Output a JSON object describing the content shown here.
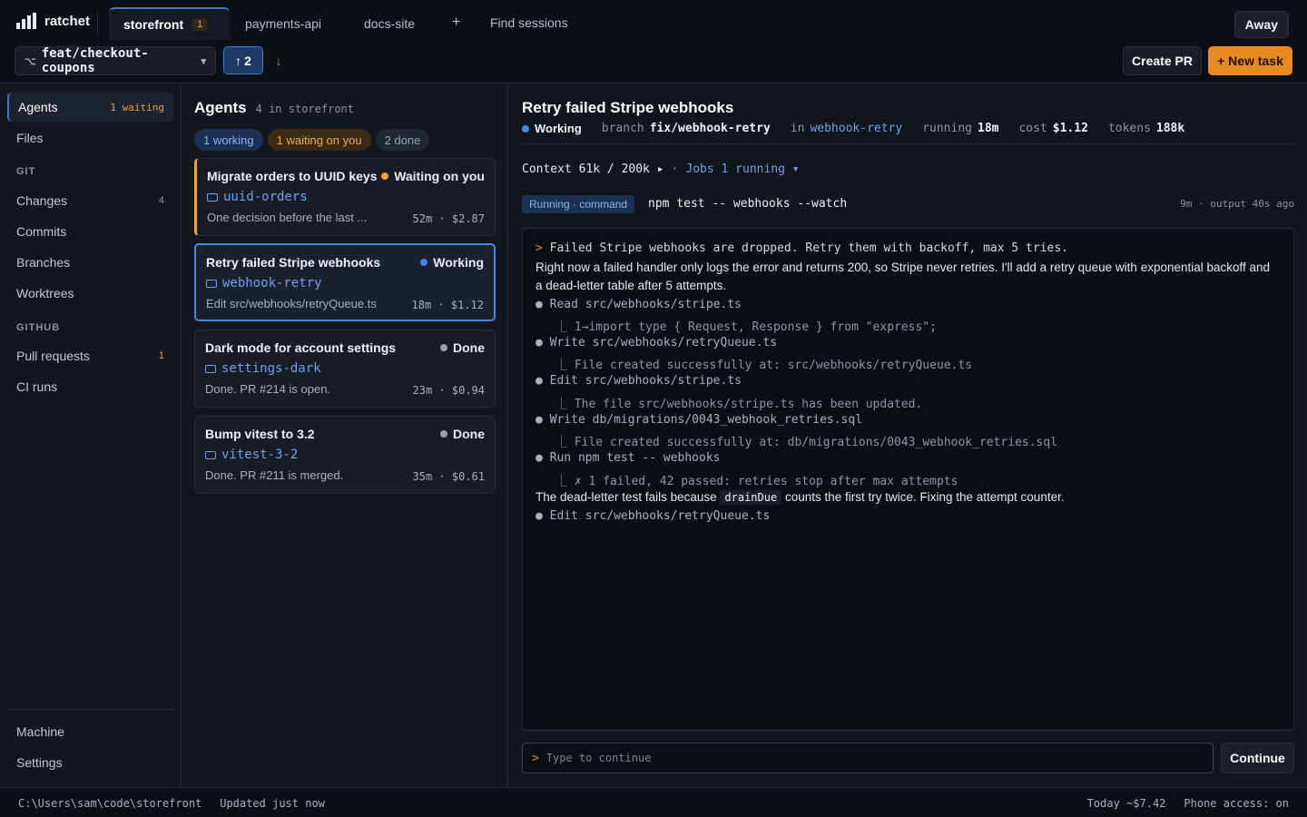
{
  "app": {
    "name": "ratchet"
  },
  "tabs": [
    {
      "label": "storefront",
      "badge": "1",
      "active": true
    },
    {
      "label": "payments-api"
    },
    {
      "label": "docs-site"
    }
  ],
  "topbar": {
    "add_tab": "+",
    "find_sessions": "Find sessions",
    "away": "Away"
  },
  "branch": {
    "name": "feat/checkout-coupons",
    "push_label": "2",
    "push_icon": "↑",
    "pull_icon": "↓"
  },
  "actions": {
    "create_pr": "Create PR",
    "new_task": "+ New task"
  },
  "sidebar": {
    "agents": {
      "label": "Agents",
      "count": "1 waiting"
    },
    "files": "Files",
    "git_header": "GIT",
    "changes": {
      "label": "Changes",
      "count": "4"
    },
    "commits": "Commits",
    "branches": "Branches",
    "worktrees": "Worktrees",
    "github_header": "GITHUB",
    "pull_requests": {
      "label": "Pull requests",
      "count": "1"
    },
    "ci_runs": "CI runs",
    "machine": "Machine",
    "settings": "Settings"
  },
  "agents_panel": {
    "title": "Agents",
    "subtitle": "4 in storefront",
    "filters": [
      "1 working",
      "1 waiting on you",
      "2 done"
    ],
    "cards": [
      {
        "title": "Migrate orders to UUID keys",
        "status": "Waiting on you",
        "status_color": "#e5a33f",
        "branch": "uuid-orders",
        "desc": "One decision before the last ...",
        "meta": "52m · $2.87"
      },
      {
        "title": "Retry failed Stripe webhooks",
        "status": "Working",
        "status_color": "#4a86e8",
        "branch": "webhook-retry",
        "desc": "Edit src/webhooks/retryQueue.ts",
        "meta": "18m · $1.12"
      },
      {
        "title": "Dark mode for account settings",
        "status": "Done",
        "status_color": "#9aa1ac",
        "branch": "settings-dark",
        "desc": "Done. PR #214 is open.",
        "meta": "23m · $0.94"
      },
      {
        "title": "Bump vitest to 3.2",
        "status": "Done",
        "status_color": "#9aa1ac",
        "branch": "vitest-3-2",
        "desc": "Done. PR #211 is merged.",
        "meta": "35m · $0.61"
      }
    ]
  },
  "detail": {
    "title": "Retry failed Stripe webhooks",
    "status": "Working",
    "branch_label": "branch",
    "branch": "fix/webhook-retry",
    "in_label": "in",
    "worktree": "webhook-retry",
    "running_label": "running",
    "running": "18m",
    "cost_label": "cost",
    "cost": "$1.12",
    "tokens_label": "tokens",
    "tokens": "188k",
    "context": "Context 61k / 200k ▸",
    "context_sep": "·",
    "jobs": "Jobs 1 running ▾",
    "running_pill": "Running · command",
    "running_cmd": "npm test -- webhooks --watch",
    "running_time": "9m · output 40s ago"
  },
  "terminal": {
    "prompt_symbol": ">",
    "prompt": "Failed Stripe webhooks are dropped. Retry them with backoff, max 5 tries.",
    "prose1": "Right now a failed handler only logs the error and returns 200, so Stripe never retries. I'll add a retry queue with exponential backoff and",
    "prose2": "a dead-letter table after 5 attempts.",
    "steps": [
      {
        "tool": "● Read src/webhooks/stripe.ts",
        "result": "⎿ 1→import type { Request, Response } from \"express\";"
      },
      {
        "tool": "● Write src/webhooks/retryQueue.ts",
        "result": "⎿ File created successfully at: src/webhooks/retryQueue.ts"
      },
      {
        "tool": "● Edit src/webhooks/stripe.ts",
        "result": "⎿ The file src/webhooks/stripe.ts has been updated."
      },
      {
        "tool": "● Write db/migrations/0043_webhook_retries.sql",
        "result": "⎿ File created successfully at: db/migrations/0043_webhook_retries.sql"
      },
      {
        "tool": "● Run npm test -- webhooks",
        "result": "⎿ ✗ 1 failed, 42 passed: retries stop after max attempts"
      }
    ],
    "prose3_a": "The dead-letter test fails because",
    "prose3_code": "drainDue",
    "prose3_b": "counts the first try twice. Fixing the attempt counter.",
    "last_tool": "● Edit src/webhooks/retryQueue.ts"
  },
  "input": {
    "prompt_symbol": ">",
    "placeholder": "Type to continue",
    "continue": "Continue"
  },
  "status_bar": {
    "path": "C:\\Users\\sam\\code\\storefront",
    "updated": "Updated just now",
    "today": "Today ~$7.42",
    "phone": "Phone access: on"
  },
  "colors": {
    "accent_blue": "#3f78d8",
    "accent_orange": "#e8891f",
    "background": "#11151c"
  }
}
